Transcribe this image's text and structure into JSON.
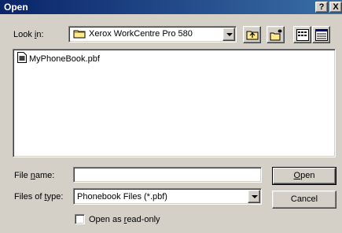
{
  "window": {
    "title": "Open",
    "help_label": "?",
    "close_label": "X"
  },
  "lookin": {
    "label_pre": "Look ",
    "label_key": "i",
    "label_post": "n:",
    "value": "Xerox WorkCentre Pro 580"
  },
  "toolbar": {
    "icons": [
      "up-folder-icon",
      "new-folder-icon",
      "list-view-icon",
      "details-view-icon"
    ]
  },
  "files": [
    {
      "name": "MyPhoneBook.pbf",
      "icon": "document-icon"
    }
  ],
  "filename": {
    "label_pre": "File ",
    "label_key": "n",
    "label_post": "ame:",
    "value": ""
  },
  "filetype": {
    "label_pre": "Files of ",
    "label_key": "t",
    "label_post": "ype:",
    "value": "Phonebook Files (*.pbf)"
  },
  "buttons": {
    "open_key": "O",
    "open_rest": "pen",
    "cancel": "Cancel"
  },
  "readonly": {
    "label_pre": "Open as ",
    "label_key": "r",
    "label_post": "ead-only",
    "checked": false
  },
  "colors": {
    "titlebar_start": "#0a246a",
    "titlebar_end": "#3a6ea5",
    "face": "#d4d0c8"
  }
}
